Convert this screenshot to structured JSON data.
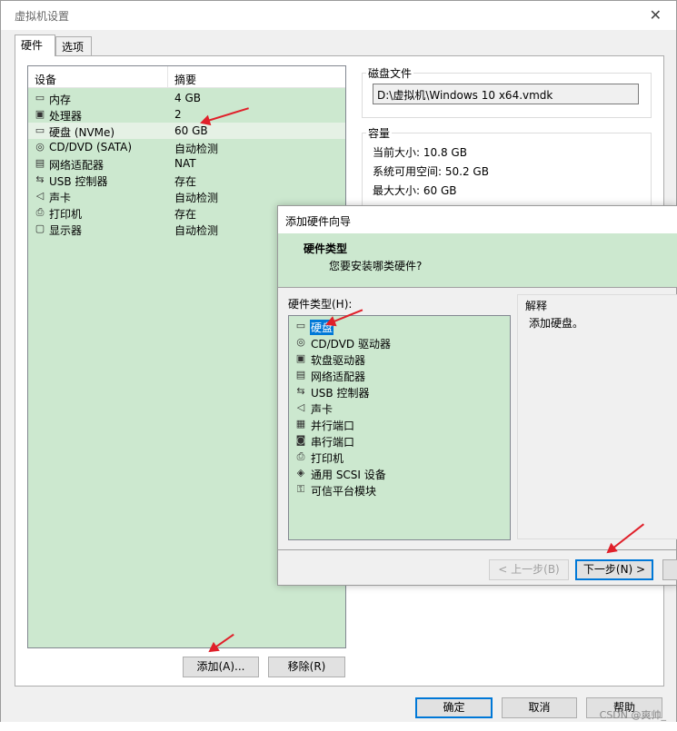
{
  "window": {
    "title": "虚拟机设置",
    "close_glyph": "✕"
  },
  "tabs": [
    {
      "label": "硬件"
    },
    {
      "label": "选项"
    }
  ],
  "device_list": {
    "col_device": "设备",
    "col_summary": "摘要",
    "rows": [
      {
        "name": "内存",
        "summary": "4 GB",
        "icon": "memory-icon"
      },
      {
        "name": "处理器",
        "summary": "2",
        "icon": "processor-icon"
      },
      {
        "name": "硬盘 (NVMe)",
        "summary": "60 GB",
        "icon": "hard-disk-icon"
      },
      {
        "name": "CD/DVD (SATA)",
        "summary": "自动检测",
        "icon": "cd-dvd-icon"
      },
      {
        "name": "网络适配器",
        "summary": "NAT",
        "icon": "network-adapter-icon"
      },
      {
        "name": "USB 控制器",
        "summary": "存在",
        "icon": "usb-icon"
      },
      {
        "name": "声卡",
        "summary": "自动检测",
        "icon": "sound-card-icon"
      },
      {
        "name": "打印机",
        "summary": "存在",
        "icon": "printer-icon"
      },
      {
        "name": "显示器",
        "summary": "自动检测",
        "icon": "display-icon"
      }
    ]
  },
  "buttons": {
    "add": "添加(A)...",
    "remove": "移除(R)",
    "ok": "确定",
    "cancel": "取消",
    "help": "帮助"
  },
  "disk_file": {
    "label": "磁盘文件",
    "value": "D:\\虚拟机\\Windows 10 x64.vmdk"
  },
  "capacity": {
    "label": "容量",
    "current": "当前大小: 10.8 GB",
    "available": "系统可用空间: 50.2 GB",
    "max": "最大大小: 60 GB"
  },
  "wizard": {
    "title": "添加硬件向导",
    "header_title": "硬件类型",
    "header_subtitle": "您要安装哪类硬件?",
    "list_label": "硬件类型(H):",
    "items": [
      {
        "name": "硬盘",
        "icon": "hard-disk-icon"
      },
      {
        "name": "CD/DVD 驱动器",
        "icon": "cd-dvd-icon"
      },
      {
        "name": "软盘驱动器",
        "icon": "floppy-icon"
      },
      {
        "name": "网络适配器",
        "icon": "network-adapter-icon"
      },
      {
        "name": "USB 控制器",
        "icon": "usb-icon"
      },
      {
        "name": "声卡",
        "icon": "sound-card-icon"
      },
      {
        "name": "并行端口",
        "icon": "parallel-port-icon"
      },
      {
        "name": "串行端口",
        "icon": "serial-port-icon"
      },
      {
        "name": "打印机",
        "icon": "printer-icon"
      },
      {
        "name": "通用 SCSI 设备",
        "icon": "scsi-icon"
      },
      {
        "name": "可信平台模块",
        "icon": "tpm-icon"
      }
    ],
    "explain_label": "解释",
    "explain_text": "添加硬盘。",
    "back": "< 上一步(B)",
    "next": "下一步(N) >"
  },
  "watermark": "CSDN @爽帅_",
  "colors": {
    "list_bg": "#cce8cf",
    "selection": "#0078d7",
    "annotation_arrow": "#e0202a"
  }
}
